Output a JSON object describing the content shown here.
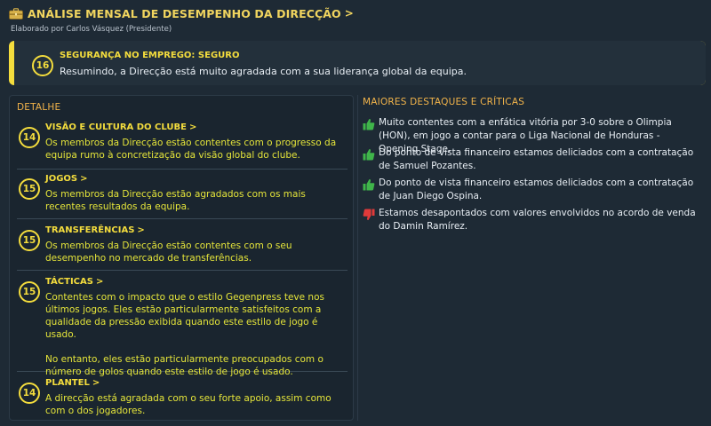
{
  "header": {
    "title": "ANÁLISE MENSAL DE DESEMPENHO DA DIRECÇÃO",
    "chevron": ">",
    "icon": "briefcase-icon",
    "subtitle": "Elaborado por Carlos Vásquez (Presidente)"
  },
  "banner": {
    "score": "16",
    "title": "SEGURANÇA NO EMPREGO: SEGURO",
    "text": "Resumindo, a Direcção está muito agradada com a sua liderança global da equipa."
  },
  "detail": {
    "title": "DETALHE",
    "items": [
      {
        "score": "14",
        "title": "VISÃO E CULTURA DO CLUBE",
        "text": "Os membros da Direcção estão contentes com o progresso da equipa rumo à concretização da visão global do clube."
      },
      {
        "score": "15",
        "title": "JOGOS",
        "text": "Os membros da Direcção estão agradados com os mais recentes resultados da equipa."
      },
      {
        "score": "15",
        "title": "TRANSFERÊNCIAS",
        "text": "Os membros da Direcção estão contentes com o seu desempenho no mercado de transferências."
      },
      {
        "score": "15",
        "title": "TÁCTICAS",
        "text": "Contentes com o impacto que o estilo Gegenpress teve nos últimos jogos. Eles estão particularmente satisfeitos com a qualidade da pressão exibida quando este estilo de jogo é usado.",
        "text2": "No entanto, eles estão particularmente preocupados com o número de golos quando este estilo de jogo é usado."
      },
      {
        "score": "14",
        "title": "PLANTEL",
        "text": "A direcção está agradada com o seu forte apoio, assim como com o dos jogadores."
      }
    ]
  },
  "highlights": {
    "title": "MAIORES DESTAQUES E CRÍTICAS",
    "items": [
      {
        "type": "thumbs-up-icon",
        "text": "Muito contentes com a enfática vitória por 3-0 sobre o Olimpia (HON), em jogo a contar para o Liga Nacional de Honduras - Opening Stage."
      },
      {
        "type": "thumbs-up-icon",
        "text": "Do ponto de vista financeiro estamos deliciados com a contratação de Samuel Pozantes."
      },
      {
        "type": "thumbs-up-icon",
        "text": "Do ponto de vista financeiro estamos deliciados com a contratação de Juan Diego Ospina."
      },
      {
        "type": "thumbs-down-icon",
        "text": "Estamos desapontados com valores envolvidos no acordo de venda do Damin Ramírez."
      }
    ]
  },
  "colors": {
    "accent_yellow": "#f4dd3d",
    "section_orange": "#f1b34a",
    "positive": "#3fb54a",
    "negative": "#e03a3a",
    "background": "#1e2a35"
  }
}
